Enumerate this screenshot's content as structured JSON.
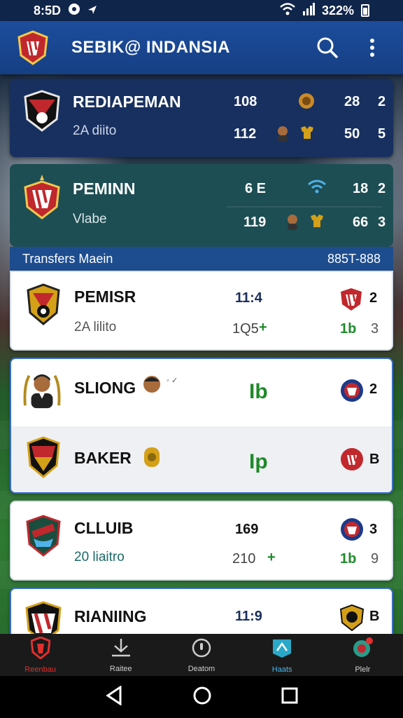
{
  "status": {
    "time": "8:5D",
    "battery": "322%"
  },
  "appbar": {
    "title": "SEBIK@ INDANSIA"
  },
  "featured": [
    {
      "name": "REDIAPEMAN",
      "sub": "2A diito",
      "r1a": "108",
      "r1b": "28",
      "r1c": "2",
      "r2a": "112",
      "r2b": "50",
      "r2c": "5"
    },
    {
      "name": "PEMINN",
      "sub": "Vlabe",
      "r1a": "6 E",
      "r1b": "18",
      "r1c": "2",
      "r2a": "119",
      "r2b": "66",
      "r2c": "3"
    }
  ],
  "section": {
    "label": "Transfers Maein",
    "range": "885T-888"
  },
  "list": [
    {
      "name": "PEMISR",
      "sub": "2A lilito",
      "val": "11:4",
      "val2": "1Q5",
      "right": "1b",
      "n1": "2",
      "n2": "3"
    },
    {
      "name": "SLIONG",
      "val": "Ib",
      "n1": "2"
    },
    {
      "name": "BAKER",
      "val": "Ip",
      "n1": "B"
    },
    {
      "name": "CLLUIB",
      "sub": "20 liaitro",
      "val": "169",
      "val2": "210",
      "right": "1b",
      "n1": "3",
      "n2": "9"
    },
    {
      "name": "RIANIING",
      "val": "11:9",
      "n1": "B"
    }
  ],
  "nav": [
    {
      "label": "Reenbau",
      "icon": "shield-icon",
      "active": true
    },
    {
      "label": "Raitee",
      "icon": "transfer-icon"
    },
    {
      "label": "Deatom",
      "icon": "circle-icon"
    },
    {
      "label": "Haats",
      "icon": "stadium-icon"
    },
    {
      "label": "Plelr",
      "icon": "profile-icon"
    }
  ],
  "colors": {
    "appbar": "#1c4d9c",
    "card_dark": "#17305f",
    "accent_green": "#1f8a2a",
    "active_nav": "#e03030"
  }
}
